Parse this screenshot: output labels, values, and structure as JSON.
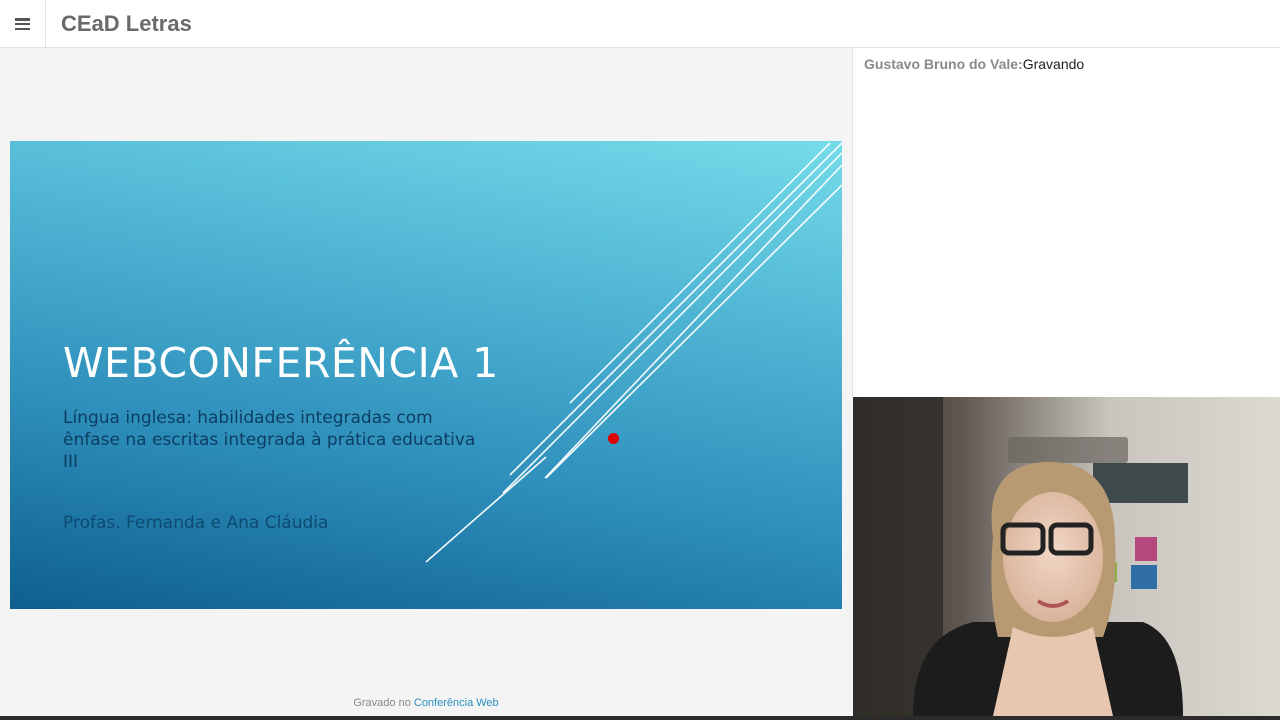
{
  "header": {
    "menu_icon": "hamburger-menu-icon",
    "title": "CEaD Letras"
  },
  "slide": {
    "title": "WEBCONFERÊNCIA 1",
    "subtitle": "Língua inglesa: habilidades integradas com ênfase na escritas integrada à prática educativa III",
    "authors": "Profas. Fernanda e Ana Cláudia",
    "pointer_color": "#e00000"
  },
  "footer": {
    "recorded_prefix": "Gravado no ",
    "recorded_link": "Conferência Web"
  },
  "chat": {
    "user": "Gustavo Bruno do Vale:",
    "message": "Gravando"
  },
  "webcam": {
    "label": "presenter-video"
  },
  "colors": {
    "accent_link": "#2a8fbf",
    "slide_top": "#74dce9",
    "slide_bottom": "#0e5f8f"
  }
}
